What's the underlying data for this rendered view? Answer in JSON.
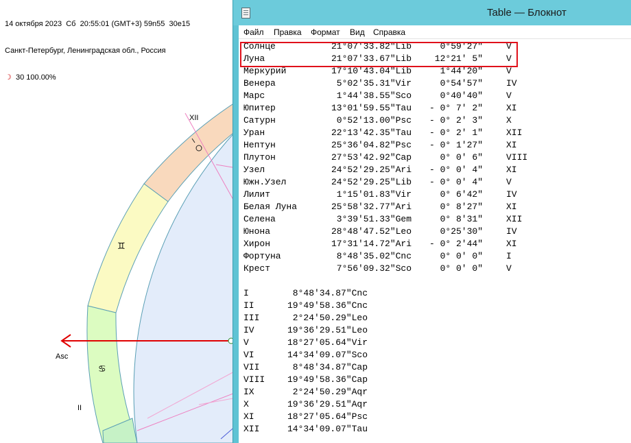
{
  "chart": {
    "header_line1": "14 октября 2023  Сб  20:55:01 (GMT+3) 59n55  30e15",
    "header_line2": "Санкт-Петербург, Ленинградская обл., Россия",
    "header_line3_symbol": "☽",
    "header_line3_text": "  30 100.00%",
    "house_labels": {
      "xii": "XII",
      "asc": "Asc",
      "ii": "II"
    },
    "sign_glyphs": {
      "taurus": "♉",
      "gemini": "♊",
      "cancer": "♋"
    },
    "colors": {
      "taurus_band": "#f9d9bd",
      "gemini_band": "#fbfac3",
      "cancer_band": "#dcfcc1",
      "leo_band": "#c6f2c6",
      "inner_disc": "#e3ecfa",
      "asc_line": "#e00000",
      "house_line": "#ee7fc0"
    }
  },
  "notepad": {
    "title": "Table — Блокнот",
    "menu": [
      "Файл",
      "Правка",
      "Формат",
      "Вид",
      "Справка"
    ],
    "planets": [
      {
        "name": "Солнце",
        "pos": "21°07'33.82\"Lib",
        "speed": "  0°59'27\"",
        "house": "V"
      },
      {
        "name": "Луна",
        "pos": "21°07'33.67\"Lib",
        "speed": " 12°21' 5\"",
        "house": "V"
      },
      {
        "name": "Меркурий",
        "pos": "17°10'43.04\"Lib",
        "speed": "  1°44'20\"",
        "house": "V"
      },
      {
        "name": "Венера",
        "pos": " 5°02'35.31\"Vir",
        "speed": "  0°54'57\"",
        "house": "IV"
      },
      {
        "name": "Марс",
        "pos": " 1°44'38.55\"Sco",
        "speed": "  0°40'40\"",
        "house": "V"
      },
      {
        "name": "Юпитер",
        "pos": "13°01'59.55\"Tau",
        "speed": "- 0° 7' 2\"",
        "house": "XI"
      },
      {
        "name": "Сатурн",
        "pos": " 0°52'13.00\"Psc",
        "speed": "- 0° 2' 3\"",
        "house": "X"
      },
      {
        "name": "Уран",
        "pos": "22°13'42.35\"Tau",
        "speed": "- 0° 2' 1\"",
        "house": "XII"
      },
      {
        "name": "Нептун",
        "pos": "25°36'04.82\"Psc",
        "speed": "- 0° 1'27\"",
        "house": "XI"
      },
      {
        "name": "Плутон",
        "pos": "27°53'42.92\"Cap",
        "speed": "  0° 0' 6\"",
        "house": "VIII"
      },
      {
        "name": "Узел",
        "pos": "24°52'29.25\"Ari",
        "speed": "- 0° 0' 4\"",
        "house": "XI"
      },
      {
        "name": "Южн.Узел",
        "pos": "24°52'29.25\"Lib",
        "speed": "- 0° 0' 4\"",
        "house": "V"
      },
      {
        "name": "Лилит",
        "pos": " 1°15'01.83\"Vir",
        "speed": "  0° 6'42\"",
        "house": "IV"
      },
      {
        "name": "Белая Луна",
        "pos": "25°58'32.77\"Ari",
        "speed": "  0° 8'27\"",
        "house": "XI"
      },
      {
        "name": "Селена",
        "pos": " 3°39'51.33\"Gem",
        "speed": "  0° 8'31\"",
        "house": "XII"
      },
      {
        "name": "Юнона",
        "pos": "28°48'47.52\"Leo",
        "speed": "  0°25'30\"",
        "house": "IV"
      },
      {
        "name": "Хирон",
        "pos": "17°31'14.72\"Ari",
        "speed": "- 0° 2'44\"",
        "house": "XI"
      },
      {
        "name": "Фортуна",
        "pos": " 8°48'35.02\"Cnc",
        "speed": "  0° 0' 0\"",
        "house": "I"
      },
      {
        "name": "Крест",
        "pos": " 7°56'09.32\"Sco",
        "speed": "  0° 0' 0\"",
        "house": "V"
      }
    ],
    "houses": [
      {
        "num": "I",
        "pos": " 8°48'34.87\"Cnc"
      },
      {
        "num": "II",
        "pos": "19°49'58.36\"Cnc"
      },
      {
        "num": "III",
        "pos": " 2°24'50.29\"Leo"
      },
      {
        "num": "IV",
        "pos": "19°36'29.51\"Leo"
      },
      {
        "num": "V",
        "pos": "18°27'05.64\"Vir"
      },
      {
        "num": "VI",
        "pos": "14°34'09.07\"Sco"
      },
      {
        "num": "VII",
        "pos": " 8°48'34.87\"Cap"
      },
      {
        "num": "VIII",
        "pos": "19°49'58.36\"Cap"
      },
      {
        "num": "IX",
        "pos": " 2°24'50.29\"Aqr"
      },
      {
        "num": "X",
        "pos": "19°36'29.51\"Aqr"
      },
      {
        "num": "XI",
        "pos": "18°27'05.64\"Psc"
      },
      {
        "num": "XII",
        "pos": "14°34'09.07\"Tau"
      }
    ]
  }
}
